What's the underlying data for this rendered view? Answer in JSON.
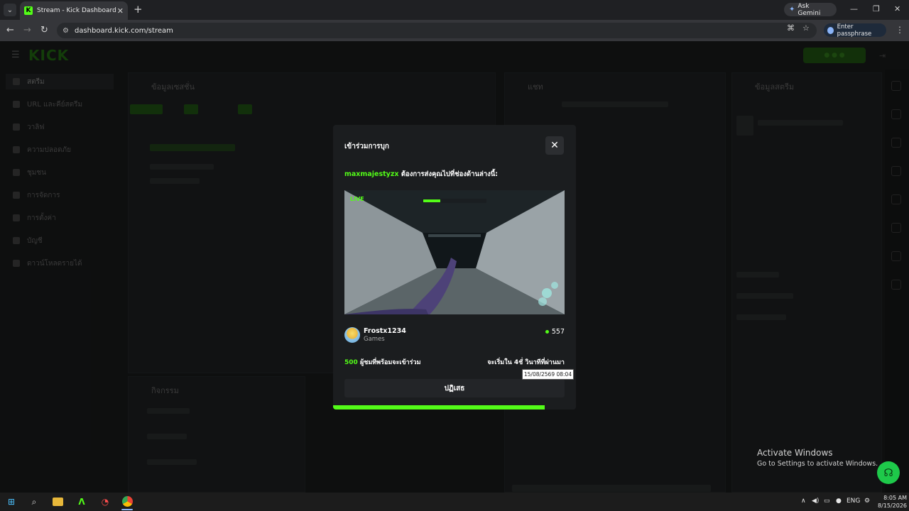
{
  "browser": {
    "tab_title": "Stream - Kick Dashboard",
    "tab_favicon": "K",
    "url": "dashboard.kick.com/stream",
    "gemini_label": "Ask Gemini",
    "passphrase_label": "Enter passphrase"
  },
  "dashboard": {
    "logo": "KICK",
    "sidebar": [
      {
        "label": "สตรีม"
      },
      {
        "label": "URL และคีย์สตรีม"
      },
      {
        "label": "วาลิฟ"
      },
      {
        "label": "ความปลอดภัย"
      },
      {
        "label": "ชุมชน"
      },
      {
        "label": "การจัดการ"
      },
      {
        "label": "การตั้งค่า"
      },
      {
        "label": "บัญชี"
      },
      {
        "label": "ดาวน์โหลดรายได้"
      }
    ],
    "panels": {
      "session": "ข้อมูลเซสชั่น",
      "chat": "แชท",
      "stream_info": "ข้อมูลสตรีม",
      "activity": "กิจกรรม"
    }
  },
  "modal": {
    "title": "เข้าร่วมการบุก",
    "raider": "maxmajestyzx",
    "raid_message": "ต้องการส่งคุณไปที่ช่องด้านล่างนี้:",
    "live_badge": "LIVE",
    "streamer_name": "Frostx1234",
    "streamer_category": "Games",
    "viewer_count": "557",
    "raid_viewers": "500",
    "raid_viewers_label": "ผู้ชมที่พร้อมจะเข้าร่วม",
    "countdown": "จะเริ่มใน 4ชั่ วินาทีที่ผ่านมา",
    "tooltip": "15/08/2569 08:04",
    "decline_label": "ปฏิเสธ",
    "progress": 0.87
  },
  "windows": {
    "activate_title": "Activate Windows",
    "activate_sub": "Go to Settings to activate Windows.",
    "tray_lang": "ENG",
    "time": "8:05 AM",
    "date": "8/15/2026"
  },
  "colors": {
    "kick_green": "#53fc18",
    "modal_bg": "#1b1d1f"
  }
}
